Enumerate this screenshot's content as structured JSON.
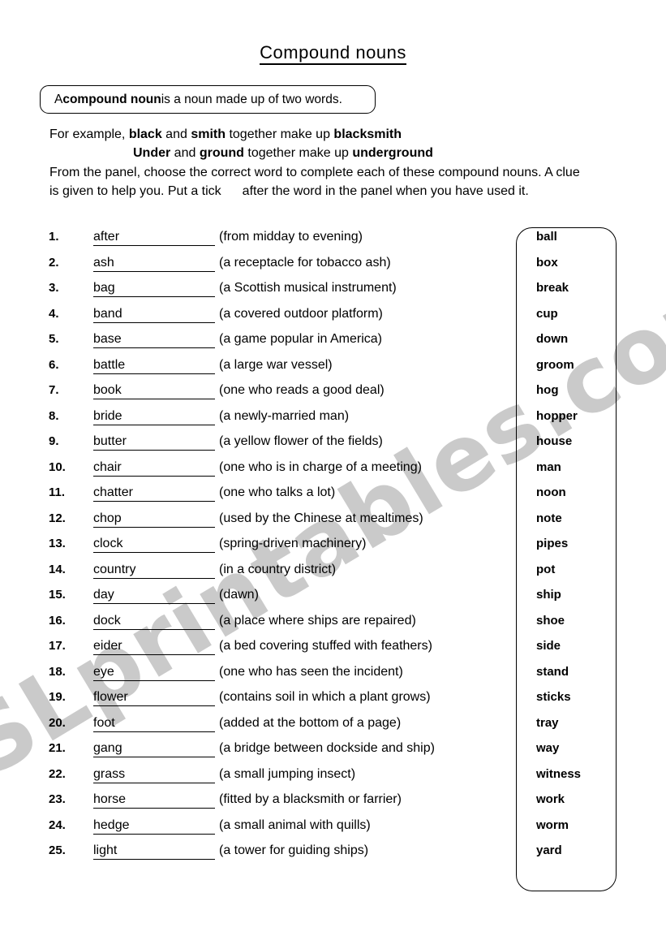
{
  "watermark": {
    "text": "ESLprintables.com",
    "color": "#cacaca"
  },
  "title": "Compound nouns",
  "definition_box": {
    "prefix": "A ",
    "term": "compound noun",
    "suffix": " is a noun made up of two words."
  },
  "examples": [
    {
      "lead": "For example, ",
      "word1": "black",
      "conj": " and ",
      "word2": "smith",
      "mid": " together make up ",
      "result": "blacksmith"
    },
    {
      "lead": "",
      "word1": "Under",
      "conj": " and ",
      "word2": "ground",
      "mid": "  together make up ",
      "result": "underground"
    }
  ],
  "instructions": {
    "line1": "From the panel, choose the correct word to complete each of these compound nouns.  A clue",
    "line2_a": "is given to help you.  Put a tick",
    "line2_b": "after the word in the panel when you have used it."
  },
  "items": [
    {
      "num": "1.",
      "stem": "after",
      "clue": "(from midday to evening)"
    },
    {
      "num": "2.",
      "stem": "ash",
      "clue": "(a receptacle for tobacco ash)"
    },
    {
      "num": "3.",
      "stem": "bag",
      "clue": "(a Scottish musical instrument)"
    },
    {
      "num": "4.",
      "stem": "band",
      "clue": "(a covered outdoor platform)"
    },
    {
      "num": "5.",
      "stem": "base",
      "clue": "(a game popular in America)"
    },
    {
      "num": "6.",
      "stem": "battle",
      "clue": "(a large war vessel)"
    },
    {
      "num": "7.",
      "stem": "book",
      "clue": "(one who reads a good deal)"
    },
    {
      "num": "8.",
      "stem": "bride",
      "clue": "(a newly-married man)"
    },
    {
      "num": "9.",
      "stem": "butter",
      "clue": "(a yellow flower of the fields)"
    },
    {
      "num": "10.",
      "stem": "chair",
      "clue": "(one who is in charge of a meeting)"
    },
    {
      "num": "11.",
      "stem": "chatter",
      "clue": "(one who talks a lot)"
    },
    {
      "num": "12.",
      "stem": "chop",
      "clue": "(used by the Chinese at mealtimes)"
    },
    {
      "num": "13.",
      "stem": "clock",
      "clue": "(spring-driven machinery)"
    },
    {
      "num": "14.",
      "stem": "country",
      "clue": "(in a country district)"
    },
    {
      "num": "15.",
      "stem": "day",
      "clue": "(dawn)"
    },
    {
      "num": "16.",
      "stem": "dock",
      "clue": "(a place where ships are repaired)"
    },
    {
      "num": "17.",
      "stem": "eider",
      "clue": "(a bed covering stuffed with feathers)"
    },
    {
      "num": "18.",
      "stem": "eye",
      "clue": "(one who has seen the incident)"
    },
    {
      "num": "19.",
      "stem": "flower",
      "clue": "(contains soil in which a plant grows)"
    },
    {
      "num": "20.",
      "stem": "foot",
      "clue": "(added at the bottom of a page)"
    },
    {
      "num": "21.",
      "stem": "gang",
      "clue": "(a bridge between dockside and ship)"
    },
    {
      "num": "22.",
      "stem": "grass",
      "clue": "(a small jumping insect)"
    },
    {
      "num": "23.",
      "stem": "horse",
      "clue": "(fitted by a blacksmith or farrier)"
    },
    {
      "num": "24.",
      "stem": "hedge",
      "clue": "(a small animal with quills)"
    },
    {
      "num": "25.",
      "stem": "light",
      "clue": "(a tower for guiding ships)"
    }
  ],
  "panel_words": [
    "ball",
    "box",
    "break",
    "cup",
    "down",
    "groom",
    "hog",
    "hopper",
    "house",
    "man",
    "noon",
    "note",
    "pipes",
    "pot",
    "ship",
    "shoe",
    "side",
    "stand",
    "sticks",
    "tray",
    "way",
    "witness",
    "work",
    "worm",
    "yard"
  ]
}
